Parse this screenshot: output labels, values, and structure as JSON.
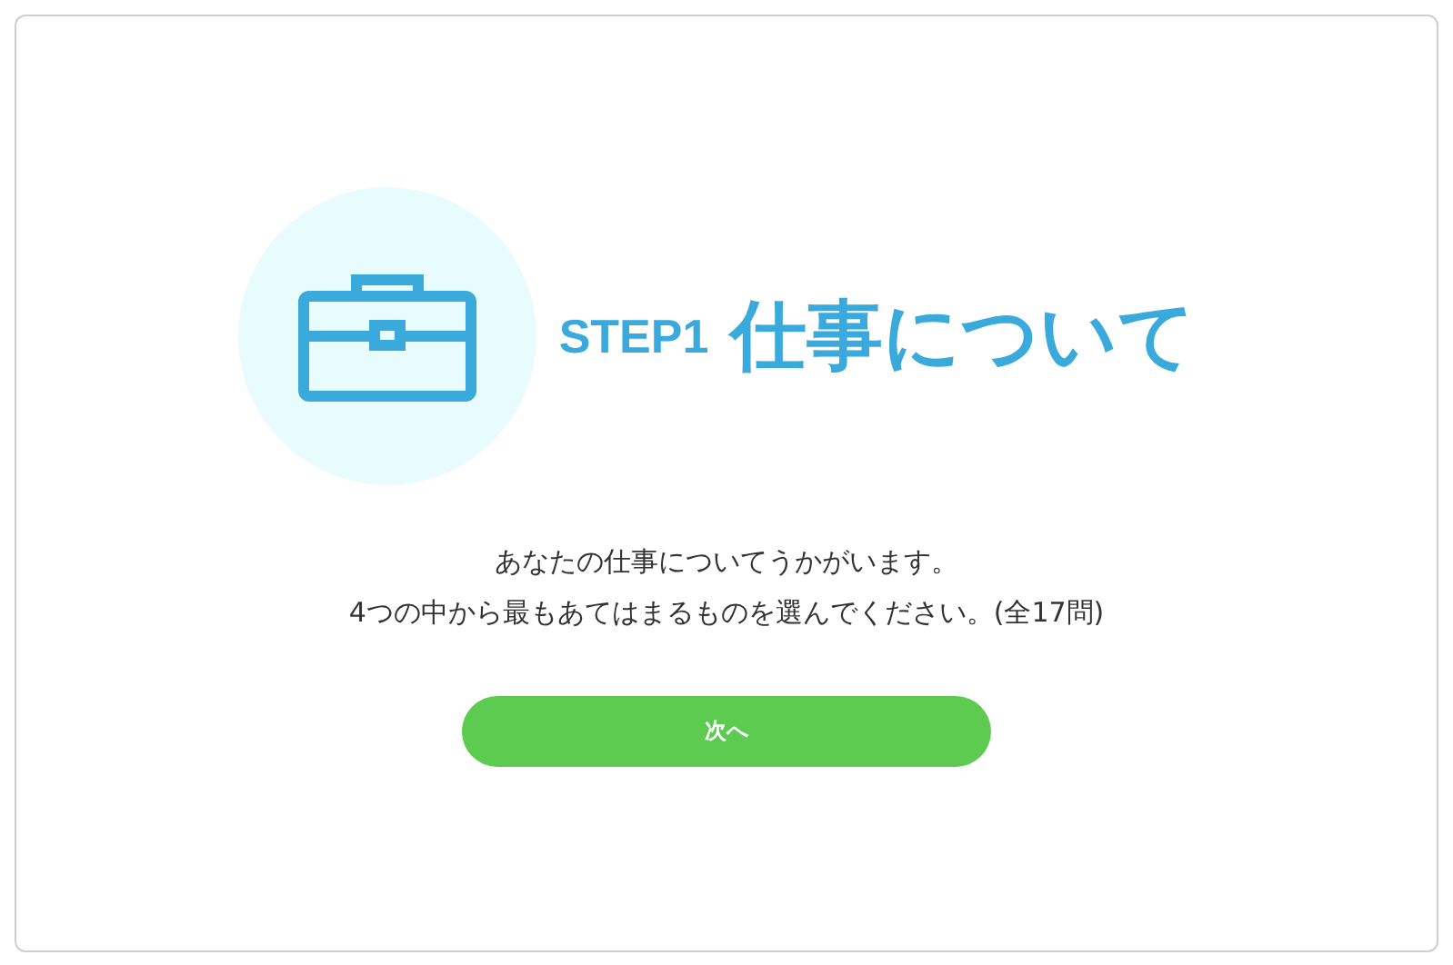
{
  "heading": {
    "step": "STEP1",
    "title": "仕事について"
  },
  "intro": [
    "あなたの仕事についてうかがいます。",
    "4つの中から最もあてはまるものを選んでください。(全17問)"
  ],
  "next_button": "次へ"
}
